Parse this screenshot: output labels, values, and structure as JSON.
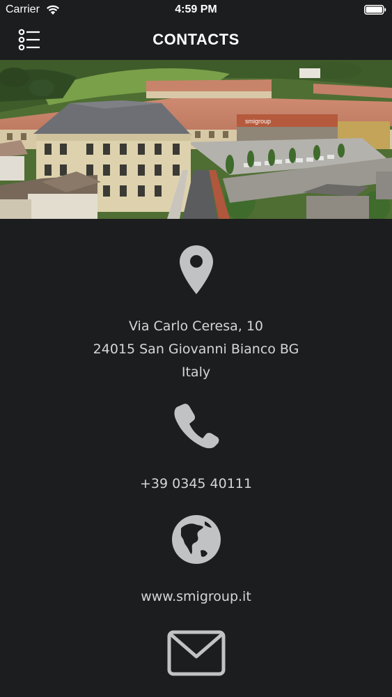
{
  "status_bar": {
    "carrier": "Carrier",
    "time": "4:59 PM",
    "wifi_icon": "wifi-icon",
    "battery_icon": "battery-icon"
  },
  "nav": {
    "title": "CONTACTS",
    "menu_icon": "list-menu-icon"
  },
  "hero": {
    "sign_text": "smigroup"
  },
  "contact": {
    "address_icon": "map-pin-icon",
    "address_line1": "Via Carlo Ceresa, 10",
    "address_line2": "24015 San Giovanni Bianco BG",
    "address_line3": "Italy",
    "phone_icon": "phone-icon",
    "phone": "+39 0345 40111",
    "web_icon": "globe-icon",
    "website": "www.smigroup.it",
    "email_icon": "envelope-icon"
  },
  "colors": {
    "background": "#1c1d1f",
    "icon": "#c1c2c4",
    "text": "#d5d6d8"
  }
}
